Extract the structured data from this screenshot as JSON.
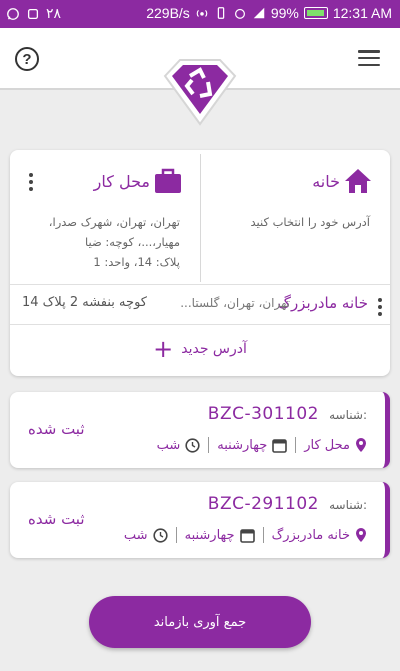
{
  "status_bar": {
    "left_count": "۲۸",
    "speed": "229B/s",
    "battery": "99%",
    "time": "12:31 AM"
  },
  "header": {
    "help_icon": "help-circle-icon",
    "menu_icon": "hamburger-menu-icon",
    "logo_icon": "recycle-diamond-logo"
  },
  "addresses": {
    "home": {
      "title": "خانه",
      "text": "آدرس خود را انتخاب کنید",
      "icon": "home-icon"
    },
    "work": {
      "title": "محل کار",
      "line1": "تهران، تهران، شهرک صدرا،",
      "line2": "مهیار،...، کوچه: ضیا",
      "line3": "پلاک: 14، واحد: 1",
      "icon": "briefcase-icon"
    },
    "extra": {
      "title": "خانه مادربزرگ",
      "addr": "تهران، تهران، گلستا...",
      "street": "کوچه بنفشه 2 پلاک 14"
    },
    "new_label": "آدرس جدید"
  },
  "orders": [
    {
      "id_label": "شناسه:",
      "id": "BZC-301102",
      "location": "محل کار",
      "day": "چهارشنبه",
      "time": "شب",
      "status": "ثبت شده"
    },
    {
      "id_label": "شناسه:",
      "id": "BZC-291102",
      "location": "خانه مادربزرگ",
      "day": "چهارشنبه",
      "time": "شب",
      "status": "ثبت شده"
    }
  ],
  "collect_button": "جمع آوری بازماند",
  "colors": {
    "accent": "#8c2aa1",
    "background": "#ededed",
    "battery": "#7ee06b"
  }
}
